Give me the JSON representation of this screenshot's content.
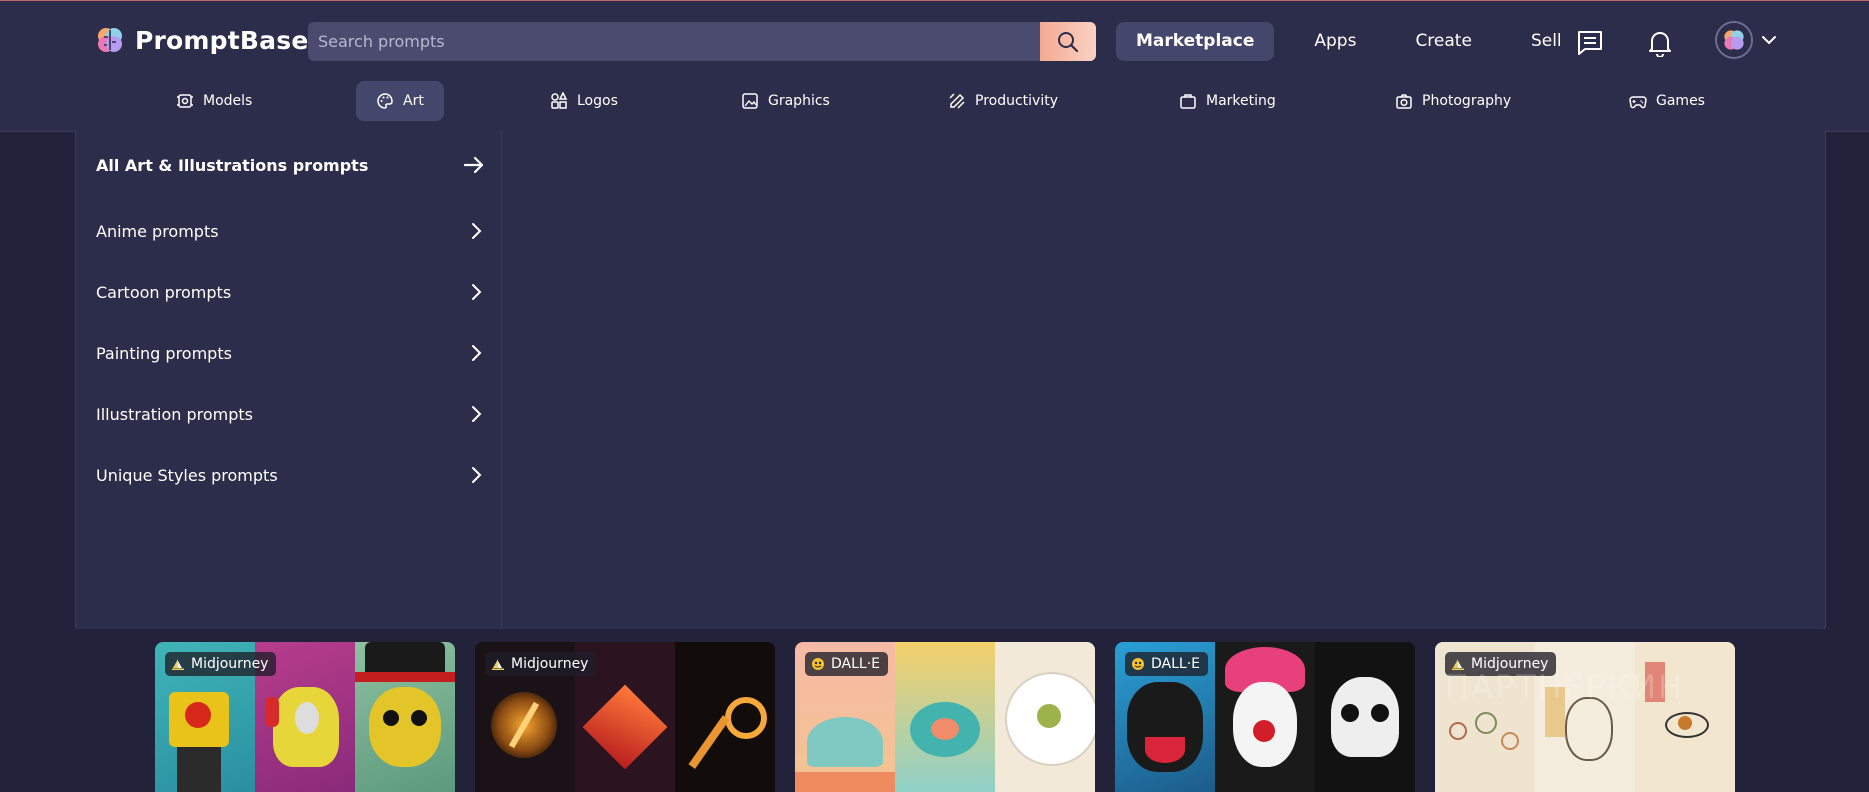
{
  "brand": {
    "name": "PromptBase"
  },
  "search": {
    "placeholder": "Search prompts"
  },
  "nav": {
    "marketplace": "Marketplace",
    "apps": "Apps",
    "create": "Create",
    "sell": "Sell"
  },
  "categories": [
    {
      "label": "Models",
      "icon": "models-icon"
    },
    {
      "label": "Art",
      "icon": "palette-icon",
      "active": true
    },
    {
      "label": "Logos",
      "icon": "shapes-icon"
    },
    {
      "label": "Graphics",
      "icon": "image-icon"
    },
    {
      "label": "Productivity",
      "icon": "pen-ruler-icon"
    },
    {
      "label": "Marketing",
      "icon": "briefcase-icon"
    },
    {
      "label": "Photography",
      "icon": "camera-icon"
    },
    {
      "label": "Games",
      "icon": "gamepad-icon"
    }
  ],
  "art_menu": {
    "all_label": "All Art & Illustrations prompts",
    "items": [
      "Anime prompts",
      "Cartoon prompts",
      "Painting prompts",
      "Illustration prompts",
      "Unique Styles prompts"
    ]
  },
  "cards": [
    {
      "model": "Midjourney"
    },
    {
      "model": "Midjourney"
    },
    {
      "model": "DALL·E"
    },
    {
      "model": "DALL·E"
    },
    {
      "model": "Midjourney"
    }
  ],
  "watermark": "ПАРТНЕРКИН",
  "colors": {
    "background": "#22223a",
    "header": "#2c2d4a",
    "search_button": "#f4a991",
    "active_pill": "#45466b"
  }
}
